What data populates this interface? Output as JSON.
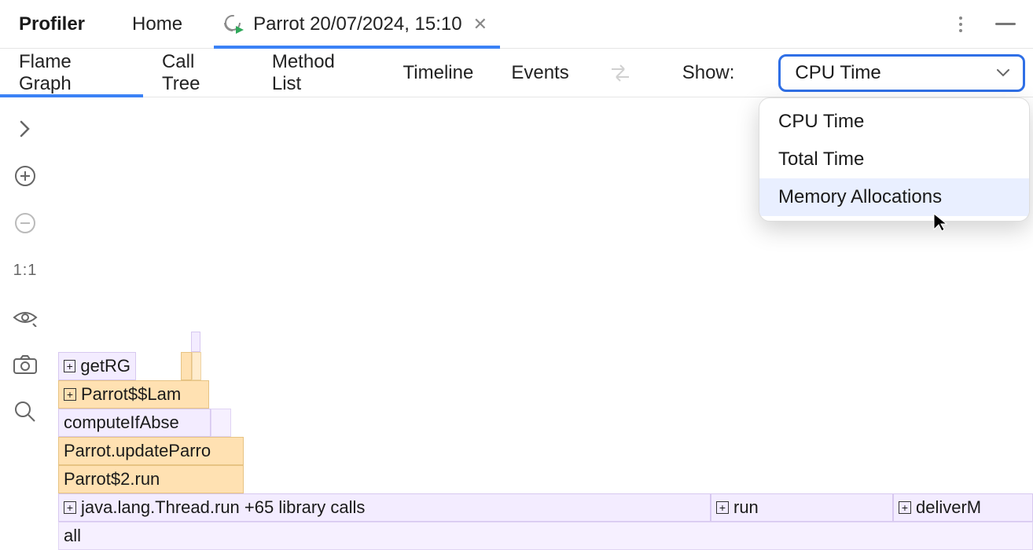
{
  "header": {
    "title": "Profiler",
    "tabs": [
      {
        "label": "Home",
        "active": false
      },
      {
        "label": "Parrot 20/07/2024, 15:10",
        "active": true,
        "closable": true
      }
    ]
  },
  "toolbar": {
    "tabs": [
      {
        "label": "Flame Graph",
        "active": true
      },
      {
        "label": "Call Tree"
      },
      {
        "label": "Method List"
      },
      {
        "label": "Timeline"
      },
      {
        "label": "Events"
      }
    ],
    "show_label": "Show:",
    "show_selected": "CPU Time",
    "show_options": [
      {
        "label": "CPU Time"
      },
      {
        "label": "Total Time"
      },
      {
        "label": "Memory Allocations",
        "hovered": true
      }
    ]
  },
  "rail": {
    "ratio_label": "1:1"
  },
  "flame": {
    "rows": [
      {
        "label": "all"
      },
      {
        "label": "java.lang.Thread.run  +65 library calls",
        "expand": true
      },
      {
        "label": "run",
        "expand": true
      },
      {
        "label": "deliverM",
        "expand": true
      },
      {
        "label": "Parrot$2.run"
      },
      {
        "label": "Parrot.updateParro"
      },
      {
        "label": "computeIfAbse"
      },
      {
        "label": "Parrot$$Lam",
        "expand": true
      },
      {
        "label": "getRG",
        "expand": true
      }
    ]
  }
}
